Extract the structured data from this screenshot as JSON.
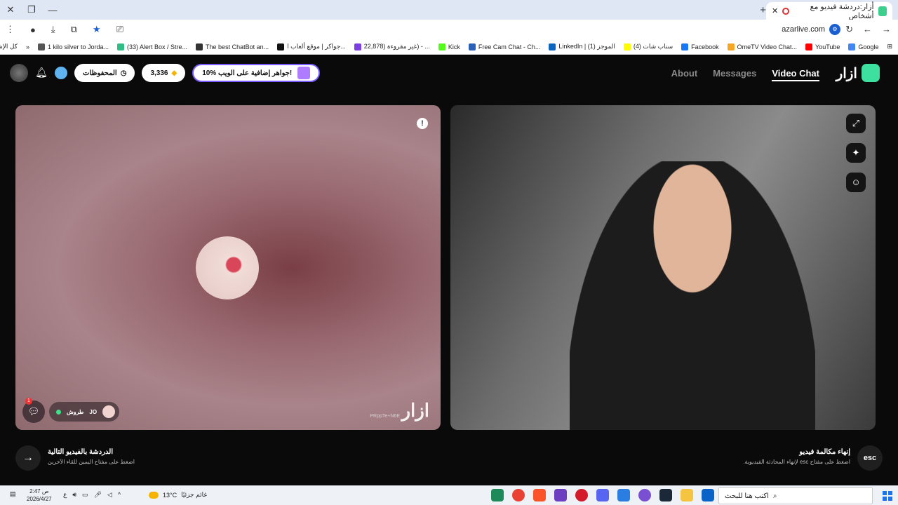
{
  "browser": {
    "tab_title": "أزار:دردشة فيديو مع أشخاص",
    "url": "azarlive.com",
    "bookmarks": [
      {
        "label": "Google",
        "color": "#4285f4"
      },
      {
        "label": "YouTube",
        "color": "#ff0000"
      },
      {
        "label": "OmeTV Video Chat...",
        "color": "#f5a623"
      },
      {
        "label": "Facebook",
        "color": "#1877f2"
      },
      {
        "label": "(4) سناب شات",
        "color": "#fffc00"
      },
      {
        "label": "LinkedIn | (1) الموجز",
        "color": "#0a66c2"
      },
      {
        "label": "Free Cam Chat - Ch...",
        "color": "#2a5fb8"
      },
      {
        "label": "Kick",
        "color": "#53fc18"
      },
      {
        "label": "22,878) غير مقروءة) - ...",
        "color": "#7b3fe4"
      },
      {
        "label": "جواكر | موقع ألعاب ا...",
        "color": "#111111"
      },
      {
        "label": "The best ChatBot an...",
        "color": "#333333"
      },
      {
        "label": "(33) Alert Box / Stre...",
        "color": "#2dbd85"
      },
      {
        "label": "1 kilo silver to Jorda...",
        "color": "#555555"
      }
    ],
    "bookmarks_folder": "كل الإشارات المرجعية"
  },
  "app": {
    "logo": "ازار",
    "nav": [
      {
        "label": "Video Chat",
        "active": true
      },
      {
        "label": "Messages",
        "active": false
      },
      {
        "label": "About",
        "active": false
      }
    ],
    "promo": "10% جواهر إضافية على الويب!",
    "gems": "3,336",
    "saved": "المحفوظات"
  },
  "left_panel": {
    "watermark": "ازار",
    "session_id": "PRppTe+N6E",
    "chat_badge": "1",
    "user_name": "طروش",
    "user_country": "JO"
  },
  "controls": {
    "next_title": "الدردشة بالفيديو التالية",
    "next_hint": "اضغط على مفتاح اليمين للقاء الآخرين",
    "esc_label": "esc",
    "end_title": "إنهاء مكالمة فيديو",
    "end_hint": "اضغط على مفتاح esc لإنهاء المحادثة الفيديوية."
  },
  "taskbar": {
    "time": "2:47 ص",
    "date": "2026/4/27",
    "lang": "ع",
    "temp": "13°C",
    "weather": "غائم جزئيًا",
    "search_placeholder": "اكتب هنا للبحث"
  }
}
